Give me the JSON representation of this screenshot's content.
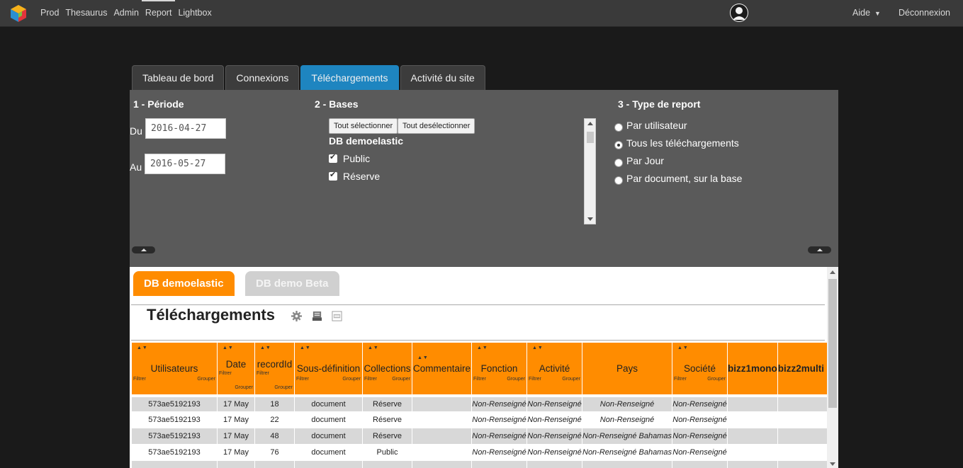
{
  "nav": {
    "items": [
      "Prod",
      "Thesaurus",
      "Admin",
      "Report",
      "Lightbox"
    ],
    "active": "Report",
    "help_label": "Aide",
    "logout_label": "Déconnexion"
  },
  "tabs": [
    "Tableau de bord",
    "Connexions",
    "Téléchargements",
    "Activité du site"
  ],
  "active_tab": "Téléchargements",
  "form": {
    "period": {
      "title": "1 - Période",
      "from_label": "Du",
      "from_value": "2016-04-27",
      "to_label": "Au",
      "to_value": "2016-05-27"
    },
    "bases": {
      "title": "2 - Bases",
      "select_all": "Tout sélectionner",
      "deselect_all": "Tout desélectionner",
      "db_name": "DB demoelastic",
      "collections": [
        {
          "label": "Public",
          "checked": true
        },
        {
          "label": "Réserve",
          "checked": true
        }
      ]
    },
    "report_type": {
      "title": "3 - Type de report",
      "options": [
        {
          "label": "Par utilisateur",
          "checked": false
        },
        {
          "label": "Tous les téléchargements",
          "checked": true
        },
        {
          "label": "Par Jour",
          "checked": false
        },
        {
          "label": "Par document, sur la base",
          "checked": false
        }
      ]
    }
  },
  "results": {
    "db_tabs": [
      "DB demoelastic",
      "DB demo Beta"
    ],
    "title": "Téléchargements",
    "filter_label": "Filtrer",
    "group_label": "Grouper",
    "columns": [
      "Utilisateurs",
      "Date",
      "recordId",
      "Sous-définition",
      "Collections",
      "Commentaire",
      "Fonction",
      "Activité",
      "Pays",
      "Société",
      "bizz1mono",
      "bizz2multi"
    ],
    "rows": [
      [
        "573ae5192193",
        "17 May",
        "18",
        "document",
        "Réserve",
        "",
        "Non-Renseigné",
        "Non-Renseigné",
        "Non-Renseigné",
        "Non-Renseigné",
        "",
        ""
      ],
      [
        "573ae5192193",
        "17 May",
        "22",
        "document",
        "Réserve",
        "",
        "Non-Renseigné",
        "Non-Renseigné",
        "Non-Renseigné",
        "Non-Renseigné",
        "",
        ""
      ],
      [
        "573ae5192193",
        "17 May",
        "48",
        "document",
        "Réserve",
        "",
        "Non-Renseigné",
        "Non-Renseigné",
        "Non-Renseigné Bahamas",
        "Non-Renseigné",
        "",
        ""
      ],
      [
        "573ae5192193",
        "17 May",
        "76",
        "document",
        "Public",
        "",
        "Non-Renseigné",
        "Non-Renseigné",
        "Non-Renseigné Bahamas",
        "Non-Renseigné",
        "",
        ""
      ]
    ]
  },
  "colors": {
    "accent_orange": "#ff8c00",
    "active_tab_blue": "#1e85c0"
  }
}
